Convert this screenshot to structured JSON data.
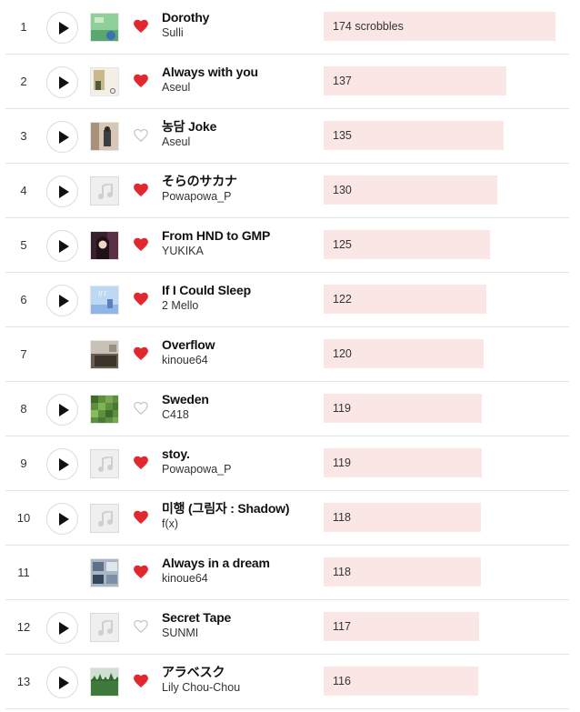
{
  "colors": {
    "loved": "#e0282e",
    "unloved": "#c4c4c4",
    "bar": "#fbe6e6"
  },
  "max_scrobbles": 174,
  "tracks": [
    {
      "rank": "1",
      "title": "Dorothy",
      "artist": "Sulli",
      "scrobbles": 174,
      "scrobbles_label": "174 scrobbles",
      "loved": true,
      "playable": true,
      "art": "art-dorothy"
    },
    {
      "rank": "2",
      "title": "Always with you",
      "artist": "Aseul",
      "scrobbles": 137,
      "scrobbles_label": "137",
      "loved": true,
      "playable": true,
      "art": "art-always-with-you"
    },
    {
      "rank": "3",
      "title": "농담 Joke",
      "artist": "Aseul",
      "scrobbles": 135,
      "scrobbles_label": "135",
      "loved": false,
      "playable": true,
      "art": "art-joke"
    },
    {
      "rank": "4",
      "title": "そらのサカナ",
      "artist": "Powapowa_P",
      "scrobbles": 130,
      "scrobbles_label": "130",
      "loved": true,
      "playable": true,
      "art": "placeholder"
    },
    {
      "rank": "5",
      "title": "From HND to GMP",
      "artist": "YUKIKA",
      "scrobbles": 125,
      "scrobbles_label": "125",
      "loved": true,
      "playable": true,
      "art": "art-hnd-gmp"
    },
    {
      "rank": "6",
      "title": "If I Could Sleep",
      "artist": "2 Mello",
      "scrobbles": 122,
      "scrobbles_label": "122",
      "loved": true,
      "playable": true,
      "art": "art-if-i-could-sleep"
    },
    {
      "rank": "7",
      "title": "Overflow",
      "artist": "kinoue64",
      "scrobbles": 120,
      "scrobbles_label": "120",
      "loved": true,
      "playable": false,
      "art": "art-overflow"
    },
    {
      "rank": "8",
      "title": "Sweden",
      "artist": "C418",
      "scrobbles": 119,
      "scrobbles_label": "119",
      "loved": false,
      "playable": true,
      "art": "art-sweden"
    },
    {
      "rank": "9",
      "title": "stoy.",
      "artist": "Powapowa_P",
      "scrobbles": 119,
      "scrobbles_label": "119",
      "loved": true,
      "playable": true,
      "art": "placeholder"
    },
    {
      "rank": "10",
      "title": "미행 (그림자 : Shadow)",
      "artist": "f(x)",
      "scrobbles": 118,
      "scrobbles_label": "118",
      "loved": true,
      "playable": true,
      "art": "placeholder"
    },
    {
      "rank": "11",
      "title": "Always in a dream",
      "artist": "kinoue64",
      "scrobbles": 118,
      "scrobbles_label": "118",
      "loved": true,
      "playable": false,
      "art": "art-always-in-a-dream"
    },
    {
      "rank": "12",
      "title": "Secret Tape",
      "artist": "SUNMI",
      "scrobbles": 117,
      "scrobbles_label": "117",
      "loved": false,
      "playable": true,
      "art": "placeholder"
    },
    {
      "rank": "13",
      "title": "アラベスク",
      "artist": "Lily Chou-Chou",
      "scrobbles": 116,
      "scrobbles_label": "116",
      "loved": true,
      "playable": true,
      "art": "art-arabesque"
    }
  ]
}
